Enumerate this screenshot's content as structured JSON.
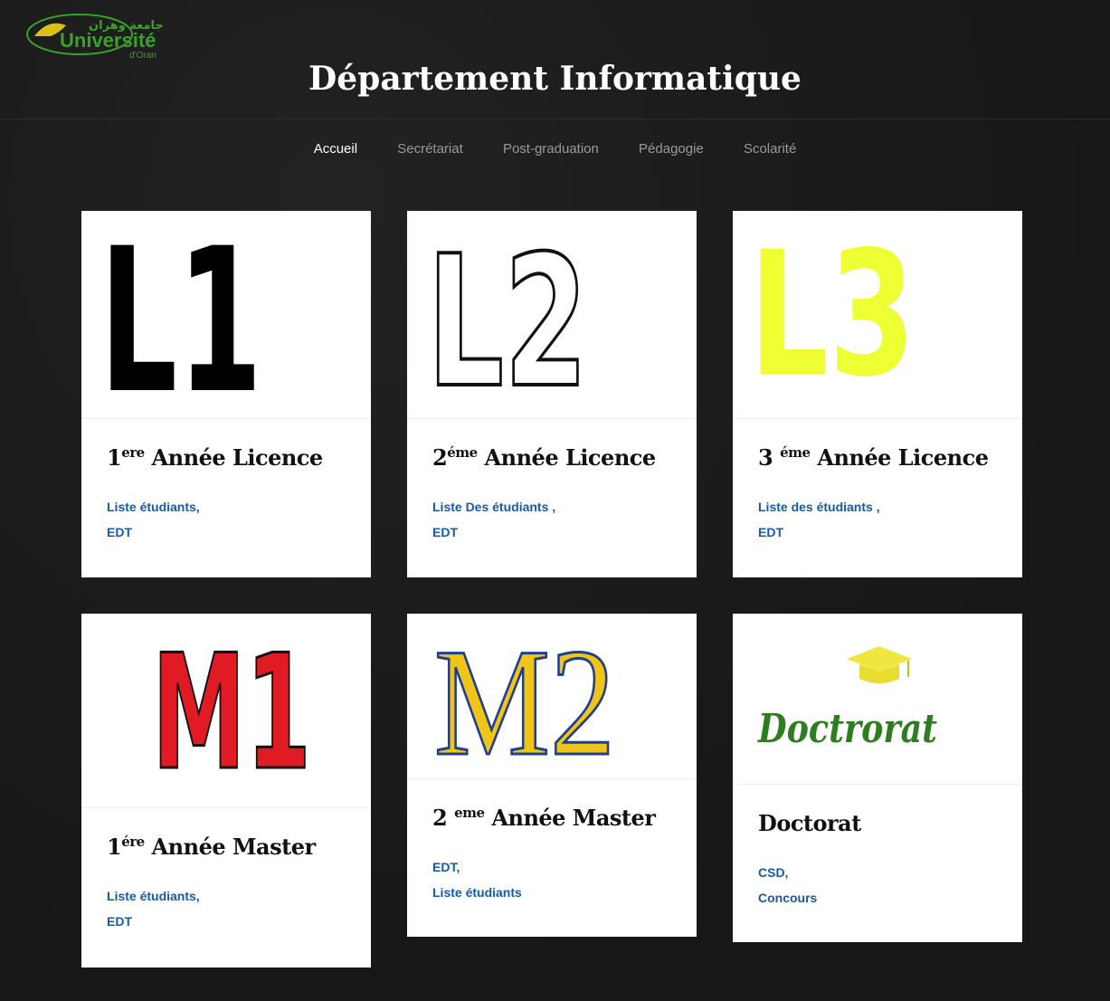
{
  "header": {
    "logo_text_arabic": "جامعة وهران",
    "logo_text_main": "Université",
    "logo_text_sub": "d'Oran",
    "title": "Département Informatique"
  },
  "nav": {
    "items": [
      {
        "label": "Accueil",
        "active": true
      },
      {
        "label": "Secrétariat",
        "active": false
      },
      {
        "label": "Post-graduation",
        "active": false
      },
      {
        "label": "Pédagogie",
        "active": false
      },
      {
        "label": "Scolarité",
        "active": false
      }
    ]
  },
  "cards": [
    {
      "image_text": "L1",
      "title_num": "1",
      "title_sup": "ere",
      "title_rest": " Année Licence",
      "links": [
        "Liste étudiants,",
        "EDT"
      ]
    },
    {
      "image_text": "L2",
      "title_num": "2",
      "title_sup": "éme",
      "title_rest": " Année Licence",
      "links": [
        "Liste Des étudiants ,",
        "EDT"
      ]
    },
    {
      "image_text": "L3",
      "title_num": "3 ",
      "title_sup": "éme",
      "title_rest": " Année Licence",
      "links": [
        "Liste des étudiants ,",
        "EDT"
      ]
    },
    {
      "image_text": "M1",
      "title_num": "1",
      "title_sup": "ére",
      "title_rest": " Année Master",
      "links": [
        "Liste étudiants,",
        "EDT"
      ]
    },
    {
      "image_text": "M2",
      "title_num": "2 ",
      "title_sup": "eme",
      "title_rest": " Année Master",
      "links": [
        "EDT,",
        "Liste étudiants"
      ]
    },
    {
      "image_text": "Doctrorat",
      "title_num": "Doctorat",
      "title_sup": "",
      "title_rest": "",
      "links": [
        "CSD,",
        "Concours"
      ]
    }
  ],
  "colors": {
    "background": "#1a1a1a",
    "link": "#1a5aa0",
    "l3_yellow": "#eeff33",
    "m1_red": "#e01b24",
    "m2_yellow": "#f0c419",
    "m2_blue": "#1f3f8f",
    "doctorat_green": "#2e7d1e",
    "logo_green": "#3aa02a"
  }
}
